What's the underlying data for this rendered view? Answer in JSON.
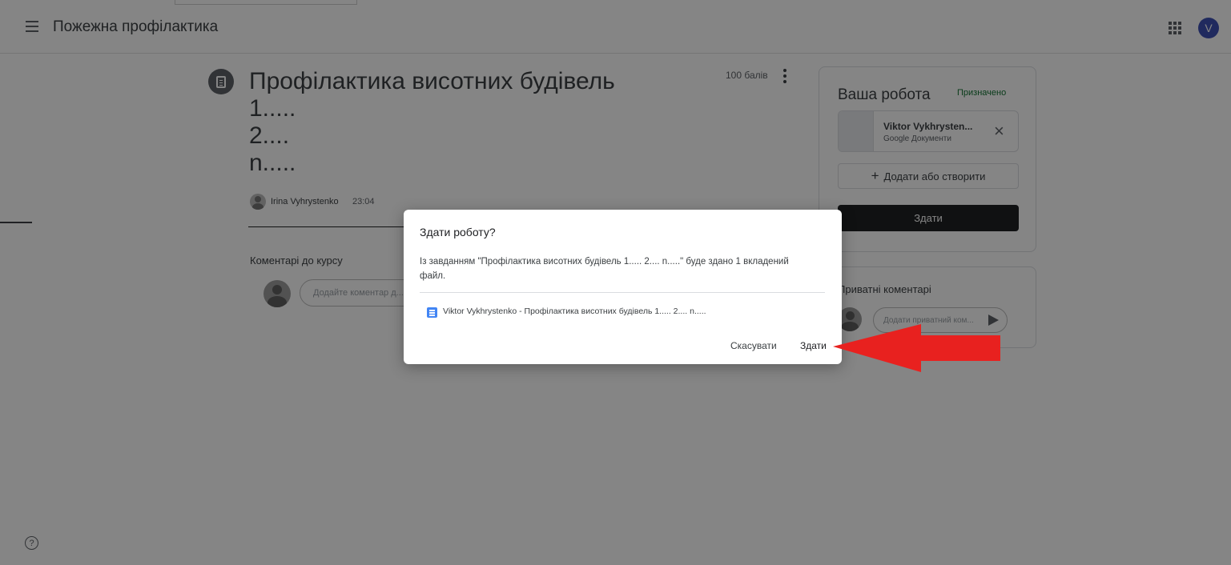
{
  "topbar": {
    "app_title": "Пожежна профілактика",
    "menu_icon": "hamburger-menu-icon",
    "apps_icon": "apps-grid-icon",
    "avatar_letter": "V",
    "avatar_color": "#3f51b5"
  },
  "assignment": {
    "icon": "assignment-icon",
    "title": "Профілактика висотних будівель\n1.....\n2....\nn.....",
    "points": "100 балів",
    "author": "Irina Vyhrystenko",
    "time": "23:04"
  },
  "class_comments": {
    "label": "Коментарі до курсу",
    "placeholder": "Додайте коментар д..."
  },
  "your_work": {
    "title": "Ваша робота",
    "status": "Призначено",
    "status_color": "#137333",
    "attachment": {
      "name": "Viktor Vykhrysten...",
      "type": "Google Документи"
    },
    "add_create_label": "Додати або створити",
    "submit_label": "Здати"
  },
  "private_comments": {
    "label": "Приватні коментарі",
    "placeholder": "Додати приватний ком..."
  },
  "dialog": {
    "title": "Здати роботу?",
    "body": "Із завданням \"Профілактика висотних будівель 1..... 2.... n.....\" буде здано 1 вкладений файл.",
    "file_icon": "google-docs-icon",
    "file_name": "Viktor Vykhrystenko - Профілактика висотних будівель 1..... 2.... n.....",
    "cancel_label": "Скасувати",
    "submit_label": "Здати"
  },
  "annotation": {
    "arrow_color": "#e8211f"
  }
}
